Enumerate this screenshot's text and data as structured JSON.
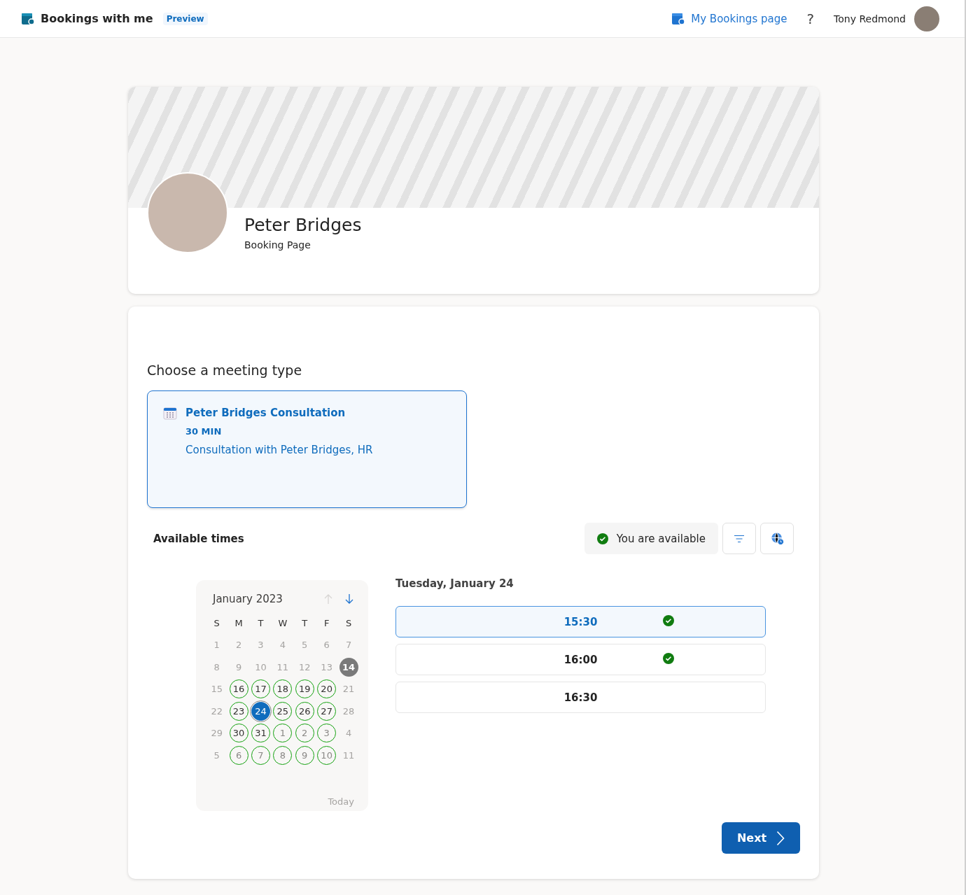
{
  "header": {
    "app_title": "Bookings with me",
    "badge": "Preview",
    "link": "My Bookings page",
    "help": "?",
    "user_name": "Tony Redmond"
  },
  "profile": {
    "name": "Peter Bridges",
    "subtitle": "Booking Page"
  },
  "meeting_section": {
    "heading": "Choose a meeting type",
    "types": [
      {
        "title": "Peter Bridges Consultation",
        "duration": "30 MIN",
        "description": "Consultation with Peter Bridges, HR",
        "selected": true
      }
    ]
  },
  "availability": {
    "heading": "Available times",
    "status": "You are available"
  },
  "calendar": {
    "month": "January 2023",
    "weekdays": [
      "S",
      "M",
      "T",
      "W",
      "T",
      "F",
      "S"
    ],
    "today_label": "Today",
    "weeks": [
      [
        {
          "day": "1",
          "kind": "past",
          "selected": false
        },
        {
          "day": "2",
          "kind": "past",
          "selected": false
        },
        {
          "day": "3",
          "kind": "past",
          "selected": false
        },
        {
          "day": "4",
          "kind": "past",
          "selected": false
        },
        {
          "day": "5",
          "kind": "past",
          "selected": false
        },
        {
          "day": "6",
          "kind": "past",
          "selected": false
        },
        {
          "day": "7",
          "kind": "past",
          "selected": false
        }
      ],
      [
        {
          "day": "8",
          "kind": "past",
          "selected": false
        },
        {
          "day": "9",
          "kind": "past",
          "selected": false
        },
        {
          "day": "10",
          "kind": "past",
          "selected": false
        },
        {
          "day": "11",
          "kind": "past",
          "selected": false
        },
        {
          "day": "12",
          "kind": "past",
          "selected": false
        },
        {
          "day": "13",
          "kind": "past",
          "selected": false
        },
        {
          "day": "14",
          "kind": "today",
          "selected": false
        }
      ],
      [
        {
          "day": "15",
          "kind": "unavailable",
          "selected": false
        },
        {
          "day": "16",
          "kind": "available",
          "selected": false
        },
        {
          "day": "17",
          "kind": "available",
          "selected": false
        },
        {
          "day": "18",
          "kind": "available",
          "selected": false
        },
        {
          "day": "19",
          "kind": "available",
          "selected": false
        },
        {
          "day": "20",
          "kind": "available",
          "selected": false
        },
        {
          "day": "21",
          "kind": "unavailable",
          "selected": false
        }
      ],
      [
        {
          "day": "22",
          "kind": "unavailable",
          "selected": false
        },
        {
          "day": "23",
          "kind": "available",
          "selected": false
        },
        {
          "day": "24",
          "kind": "available",
          "selected": true
        },
        {
          "day": "25",
          "kind": "available",
          "selected": false
        },
        {
          "day": "26",
          "kind": "available",
          "selected": false
        },
        {
          "day": "27",
          "kind": "available",
          "selected": false
        },
        {
          "day": "28",
          "kind": "unavailable",
          "selected": false
        }
      ],
      [
        {
          "day": "29",
          "kind": "unavailable",
          "selected": false
        },
        {
          "day": "30",
          "kind": "available",
          "selected": false
        },
        {
          "day": "31",
          "kind": "available",
          "selected": false
        },
        {
          "day": "1",
          "kind": "available_next",
          "selected": false
        },
        {
          "day": "2",
          "kind": "available_next",
          "selected": false
        },
        {
          "day": "3",
          "kind": "available_next",
          "selected": false
        },
        {
          "day": "4",
          "kind": "unavailable",
          "selected": false
        }
      ],
      [
        {
          "day": "5",
          "kind": "unavailable",
          "selected": false
        },
        {
          "day": "6",
          "kind": "available_next",
          "selected": false
        },
        {
          "day": "7",
          "kind": "available_next",
          "selected": false
        },
        {
          "day": "8",
          "kind": "available_next",
          "selected": false
        },
        {
          "day": "9",
          "kind": "available_next",
          "selected": false
        },
        {
          "day": "10",
          "kind": "available_next",
          "selected": false
        },
        {
          "day": "11",
          "kind": "unavailable",
          "selected": false
        }
      ]
    ]
  },
  "slots": {
    "date": "Tuesday, January 24",
    "times": [
      {
        "time": "15:30",
        "selected": true,
        "available": true
      },
      {
        "time": "16:00",
        "selected": false,
        "available": true
      },
      {
        "time": "16:30",
        "selected": false,
        "available": false
      }
    ]
  },
  "next_button": "Next"
}
